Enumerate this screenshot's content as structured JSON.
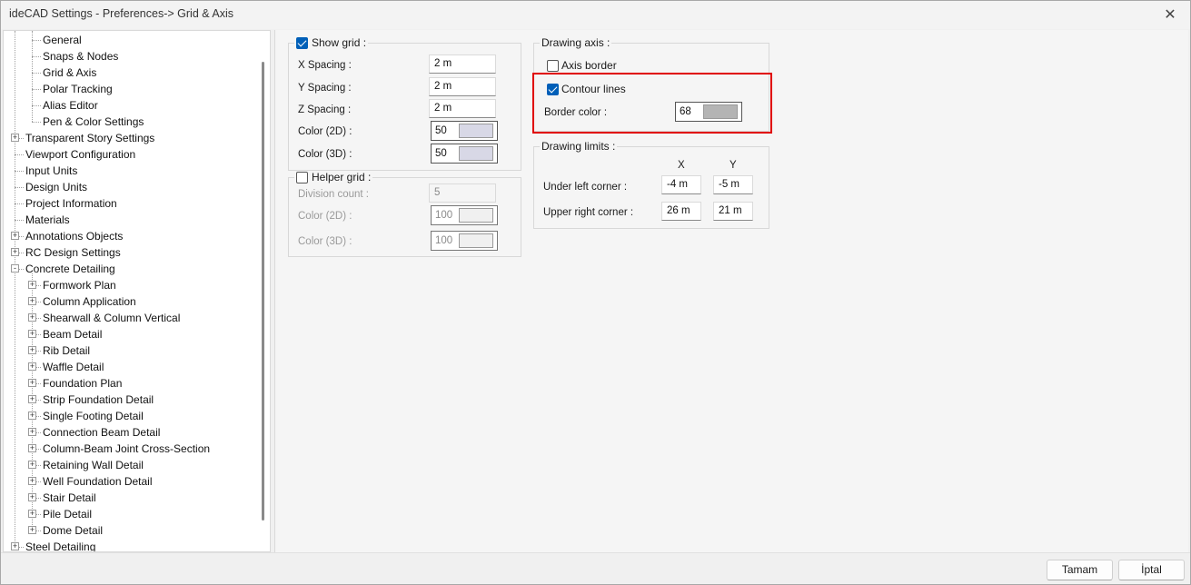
{
  "window": {
    "title": "ideCAD Settings - Preferences-> Grid & Axis"
  },
  "tree": {
    "items": [
      {
        "label": "General",
        "level": 2,
        "expander": false
      },
      {
        "label": "Snaps & Nodes",
        "level": 2,
        "expander": false
      },
      {
        "label": "Grid & Axis",
        "level": 2,
        "expander": false,
        "selected": true
      },
      {
        "label": "Polar Tracking",
        "level": 2,
        "expander": false
      },
      {
        "label": "Alias Editor",
        "level": 2,
        "expander": false
      },
      {
        "label": "Pen & Color Settings",
        "level": 2,
        "expander": false
      },
      {
        "label": "Transparent Story Settings",
        "level": 1,
        "expander": "+"
      },
      {
        "label": "Viewport Configuration",
        "level": 1,
        "expander": false
      },
      {
        "label": "Input Units",
        "level": 1,
        "expander": false
      },
      {
        "label": "Design Units",
        "level": 1,
        "expander": false
      },
      {
        "label": "Project Information",
        "level": 1,
        "expander": false
      },
      {
        "label": "Materials",
        "level": 1,
        "expander": false
      },
      {
        "label": "Annotations Objects",
        "level": 1,
        "expander": "+"
      },
      {
        "label": "RC Design Settings",
        "level": 1,
        "expander": "+"
      },
      {
        "label": "Concrete Detailing",
        "level": 1,
        "expander": "-"
      },
      {
        "label": "Formwork Plan",
        "level": 2,
        "expander": "+"
      },
      {
        "label": "Column Application",
        "level": 2,
        "expander": "+"
      },
      {
        "label": "Shearwall & Column Vertical",
        "level": 2,
        "expander": "+"
      },
      {
        "label": "Beam Detail",
        "level": 2,
        "expander": "+"
      },
      {
        "label": "Rib Detail",
        "level": 2,
        "expander": "+"
      },
      {
        "label": "Waffle Detail",
        "level": 2,
        "expander": "+"
      },
      {
        "label": "Foundation Plan",
        "level": 2,
        "expander": "+"
      },
      {
        "label": "Strip Foundation Detail",
        "level": 2,
        "expander": "+"
      },
      {
        "label": "Single Footing Detail",
        "level": 2,
        "expander": "+"
      },
      {
        "label": "Connection Beam Detail",
        "level": 2,
        "expander": "+"
      },
      {
        "label": "Column-Beam Joint Cross-Section",
        "level": 2,
        "expander": "+"
      },
      {
        "label": "Retaining Wall Detail",
        "level": 2,
        "expander": "+"
      },
      {
        "label": "Well Foundation Detail",
        "level": 2,
        "expander": "+"
      },
      {
        "label": "Stair Detail",
        "level": 2,
        "expander": "+"
      },
      {
        "label": "Pile Detail",
        "level": 2,
        "expander": "+"
      },
      {
        "label": "Dome Detail",
        "level": 2,
        "expander": "+"
      },
      {
        "label": "Steel Detailing",
        "level": 1,
        "expander": "+"
      }
    ]
  },
  "show_grid": {
    "label": "Show grid :",
    "checked": true,
    "x_spacing_label": "X Spacing :",
    "x_spacing": "2 m",
    "y_spacing_label": "Y Spacing :",
    "y_spacing": "2 m",
    "z_spacing_label": "Z Spacing :",
    "z_spacing": "2 m",
    "color2d_label": "Color (2D) :",
    "color2d": "50",
    "color2d_swatch": "#d8d8e6",
    "color3d_label": "Color (3D) :",
    "color3d": "50",
    "color3d_swatch": "#d8d8e6"
  },
  "helper_grid": {
    "label": "Helper grid :",
    "checked": false,
    "division_label": "Division count :",
    "division": "5",
    "color2d_label": "Color (2D) :",
    "color2d": "100",
    "color2d_swatch": "#f0f0f0",
    "color3d_label": "Color (3D) :",
    "color3d": "100",
    "color3d_swatch": "#f0f0f0"
  },
  "drawing_axis": {
    "label": "Drawing axis :",
    "axis_border_label": "Axis border",
    "axis_border_checked": false,
    "contour_lines_label": "Contour lines",
    "contour_lines_checked": true,
    "border_color_label": "Border color :",
    "border_color": "68",
    "border_color_swatch": "#b4b4b4"
  },
  "drawing_limits": {
    "label": "Drawing limits :",
    "col_x": "X",
    "col_y": "Y",
    "under_left_label": "Under left corner :",
    "under_left_x": "-4 m",
    "under_left_y": "-5 m",
    "upper_right_label": "Upper right corner :",
    "upper_right_x": "26 m",
    "upper_right_y": "21 m"
  },
  "buttons": {
    "ok": "Tamam",
    "cancel": "İptal"
  },
  "colors": {
    "accent": "#005fb8",
    "highlight": "#e00000"
  }
}
